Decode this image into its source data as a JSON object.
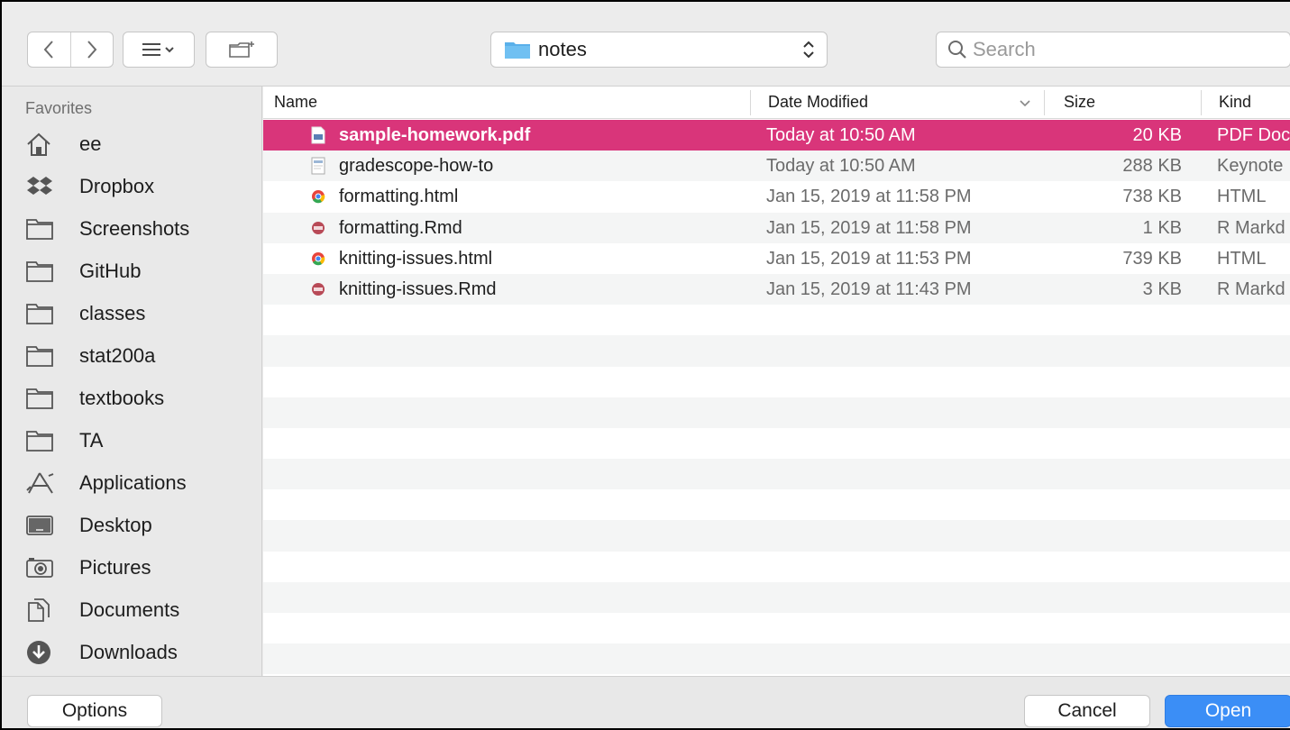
{
  "toolbar": {
    "back_icon": "chevron-left-icon",
    "forward_icon": "chevron-right-icon",
    "view_icon": "list-view-icon",
    "new_folder_icon": "new-folder-icon",
    "location": "notes",
    "search_placeholder": "Search"
  },
  "sidebar": {
    "heading": "Favorites",
    "items": [
      {
        "label": "ee",
        "icon": "home-icon"
      },
      {
        "label": "Dropbox",
        "icon": "dropbox-icon"
      },
      {
        "label": "Screenshots",
        "icon": "folder-icon"
      },
      {
        "label": "GitHub",
        "icon": "folder-icon"
      },
      {
        "label": "classes",
        "icon": "folder-icon"
      },
      {
        "label": "stat200a",
        "icon": "folder-icon"
      },
      {
        "label": "textbooks",
        "icon": "folder-icon"
      },
      {
        "label": "TA",
        "icon": "folder-icon"
      },
      {
        "label": "Applications",
        "icon": "applications-icon"
      },
      {
        "label": "Desktop",
        "icon": "desktop-icon"
      },
      {
        "label": "Pictures",
        "icon": "camera-icon"
      },
      {
        "label": "Documents",
        "icon": "documents-icon"
      },
      {
        "label": "Downloads",
        "icon": "downloads-icon"
      }
    ]
  },
  "columns": {
    "name": "Name",
    "date": "Date Modified",
    "size": "Size",
    "kind": "Kind"
  },
  "files": [
    {
      "name": "sample-homework.pdf",
      "date": "Today at 10:50 AM",
      "size": "20 KB",
      "kind": "PDF Doc",
      "icon": "pdf-icon",
      "selected": true
    },
    {
      "name": "gradescope-how-to",
      "date": "Today at 10:50 AM",
      "size": "288 KB",
      "kind": "Keynote",
      "icon": "keynote-icon"
    },
    {
      "name": "formatting.html",
      "date": "Jan 15, 2019 at 11:58 PM",
      "size": "738 KB",
      "kind": "HTML",
      "icon": "chrome-icon"
    },
    {
      "name": "formatting.Rmd",
      "date": "Jan 15, 2019 at 11:58 PM",
      "size": "1 KB",
      "kind": "R Markd",
      "icon": "rmd-icon"
    },
    {
      "name": "knitting-issues.html",
      "date": "Jan 15, 2019 at 11:53 PM",
      "size": "739 KB",
      "kind": "HTML",
      "icon": "chrome-icon"
    },
    {
      "name": "knitting-issues.Rmd",
      "date": "Jan 15, 2019 at 11:43 PM",
      "size": "3 KB",
      "kind": "R Markd",
      "icon": "rmd-icon"
    }
  ],
  "footer": {
    "options": "Options",
    "cancel": "Cancel",
    "open": "Open"
  },
  "colors": {
    "selection": "#d9357a",
    "accent": "#3b8ef6"
  }
}
